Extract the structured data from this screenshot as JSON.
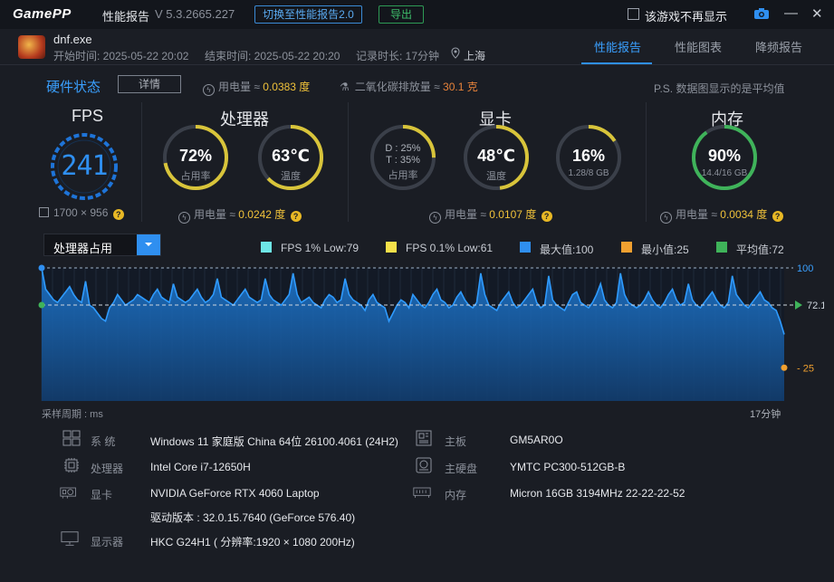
{
  "app": {
    "logo": "GamePP",
    "title": "性能报告",
    "version": "V 5.3.2665.227",
    "switch_btn": "切换至性能报告2.0",
    "export_btn": "导出",
    "no_show_label": "该游戏不再显示"
  },
  "game": {
    "name": "dnf.exe",
    "start": "开始时间: 2025-05-22 20:02",
    "end": "结束时间: 2025-05-22 20:20",
    "duration": "记录时长: 17分钟",
    "location": "上海"
  },
  "tabs": [
    {
      "label": "性能报告",
      "active": true
    },
    {
      "label": "性能图表",
      "active": false
    },
    {
      "label": "降频报告",
      "active": false
    }
  ],
  "hw": {
    "title": "硬件状态",
    "detail_btn": "详情",
    "power_label": "用电量 ≈",
    "power_value": "0.0383 度",
    "co2_label": "二氧化碳排放量 ≈",
    "co2_value": "30.1 克",
    "note": "P.S. 数据图显示的是平均值"
  },
  "fps": {
    "title": "FPS",
    "value": "241",
    "resolution": "1700 × 956"
  },
  "cpu": {
    "title": "处理器",
    "usage": "72%",
    "usage_label": "占用率",
    "usage_fraction": 0.72,
    "temp": "63℃",
    "temp_label": "温度",
    "temp_fraction": 0.63,
    "power_label": "用电量 ≈",
    "power_value": "0.0242 度"
  },
  "gpu": {
    "title": "显卡",
    "d_usage": "D : 25%",
    "t_usage": "T : 35%",
    "usage_label": "占用率",
    "usage_fraction": 0.25,
    "temp": "48℃",
    "temp_label": "温度",
    "temp_fraction": 0.48,
    "vram": "16%",
    "vram_sub": "1.28/8 GB",
    "vram_fraction": 0.16,
    "power_label": "用电量 ≈",
    "power_value": "0.0107 度"
  },
  "mem": {
    "title": "内存",
    "usage": "90%",
    "usage_sub": "14.4/16 GB",
    "usage_fraction": 0.9,
    "power_label": "用电量 ≈",
    "power_value": "0.0034 度"
  },
  "chart": {
    "selector": "处理器占用",
    "legend": [
      {
        "label": "FPS 1% Low:79",
        "color": "#6ee6e6"
      },
      {
        "label": "FPS 0.1% Low:61",
        "color": "#f5e14a"
      },
      {
        "label": "最大值:100",
        "color": "#2f8ff0"
      },
      {
        "label": "最小值:25",
        "color": "#f0a030"
      },
      {
        "label": "平均值:72",
        "color": "#3fb35a"
      }
    ],
    "max_label": "100",
    "avg_label": "72.1",
    "min_label": "25",
    "x_left": "采样周期 : ms",
    "x_right": "17分钟"
  },
  "chart_data": {
    "type": "area",
    "title": "",
    "xlabel": "采样周期 : ms",
    "ylabel": "",
    "ylim": [
      0,
      100
    ],
    "max": 100,
    "min": 25,
    "avg": 72.1,
    "y": [
      100,
      84,
      80,
      76,
      74,
      78,
      82,
      86,
      80,
      76,
      74,
      90,
      72,
      70,
      66,
      62,
      60,
      70,
      74,
      80,
      76,
      72,
      74,
      76,
      80,
      78,
      76,
      74,
      80,
      84,
      78,
      76,
      74,
      88,
      78,
      76,
      74,
      76,
      80,
      84,
      78,
      74,
      76,
      80,
      92,
      78,
      76,
      74,
      72,
      76,
      80,
      84,
      78,
      76,
      74,
      76,
      92,
      80,
      76,
      74,
      72,
      76,
      80,
      96,
      80,
      74,
      76,
      78,
      74,
      72,
      70,
      76,
      80,
      78,
      74,
      76,
      92,
      80,
      76,
      74,
      72,
      68,
      76,
      80,
      74,
      72,
      70,
      60,
      66,
      72,
      76,
      74,
      70,
      80,
      76,
      72,
      70,
      74,
      80,
      84,
      76,
      74,
      70,
      72,
      78,
      82,
      76,
      72,
      70,
      74,
      96,
      80,
      72,
      70,
      68,
      74,
      78,
      82,
      74,
      70,
      72,
      76,
      80,
      84,
      74,
      70,
      72,
      94,
      76,
      72,
      70,
      68,
      74,
      80,
      82,
      74,
      72,
      70,
      74,
      80,
      88,
      76,
      72,
      70,
      74,
      96,
      80,
      74,
      72,
      70,
      72,
      76,
      82,
      76,
      72,
      70,
      74,
      80,
      84,
      76,
      72,
      74,
      88,
      76,
      72,
      70,
      74,
      78,
      82,
      76,
      72,
      70,
      74,
      94,
      80,
      76,
      72,
      70,
      74,
      78,
      82,
      76,
      74,
      70,
      68,
      60,
      50
    ]
  },
  "sysinfo": {
    "os_label": "系 统",
    "os": "Windows 11 家庭版 China 64位 26100.4061 (24H2)",
    "cpu_label": "处理器",
    "cpu": "Intel Core i7-12650H",
    "gpu_label": "显卡",
    "gpu": "NVIDIA GeForce RTX 4060 Laptop",
    "driver": "驱动版本 : 32.0.15.7640 (GeForce 576.40)",
    "monitor_label": "显示器",
    "monitor": "HKC G24H1 ( 分辨率:1920 × 1080 200Hz)",
    "mb_label": "主板",
    "mb": "GM5AR0O",
    "disk_label": "主硬盘",
    "disk": "YMTC PC300-512GB-B",
    "ram_label": "内存",
    "ram": "Micron 16GB 3194MHz 22-22-22-52"
  },
  "colors": {
    "accent": "#2f8ff0",
    "gauge_green": "#3fb35a",
    "gauge_yellow": "#d8c43a",
    "power_yellow": "#f0c23a",
    "co2_orange": "#e8833a"
  }
}
